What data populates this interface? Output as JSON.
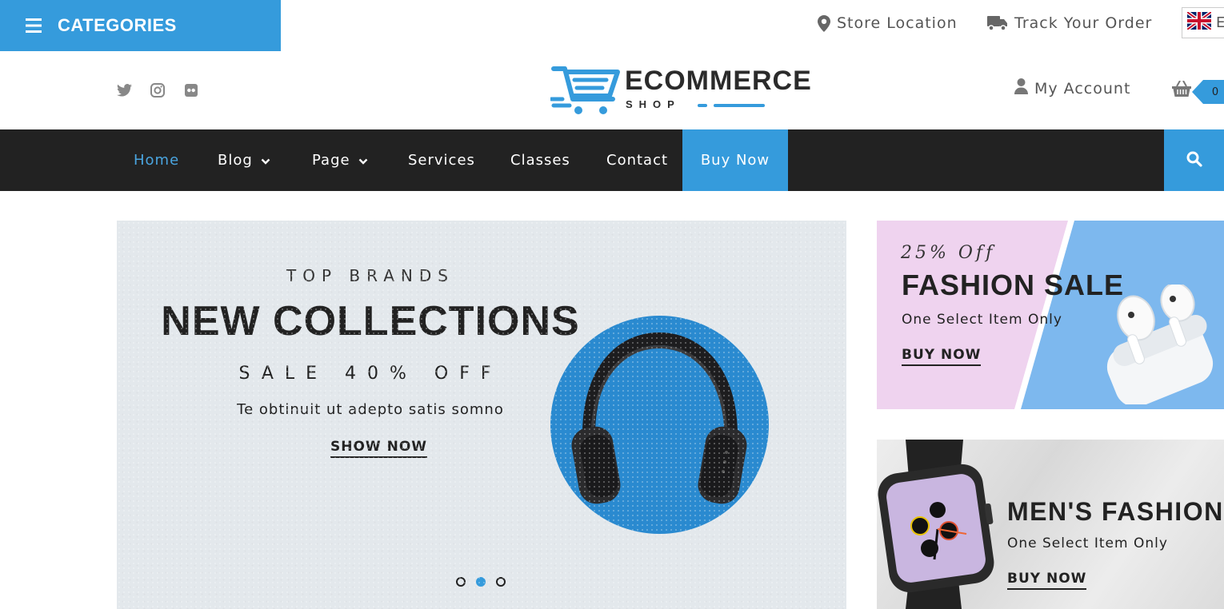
{
  "topbar": {
    "categories_label": "CATEGORIES",
    "store_location": "Store Location",
    "track_order": "Track Your Order",
    "language_partial": "E"
  },
  "header": {
    "logo_word": "ECOMMERCE",
    "logo_sub": "SHOP",
    "social": [
      "twitter-icon",
      "instagram-icon",
      "flickr-icon"
    ],
    "account_label": "My Account",
    "cart_count": "0"
  },
  "nav": {
    "items": [
      {
        "label": "Home",
        "active": true
      },
      {
        "label": "Blog",
        "dropdown": true
      },
      {
        "label": "Page",
        "dropdown": true
      },
      {
        "label": "Services"
      },
      {
        "label": "Classes"
      },
      {
        "label": "Contact"
      }
    ],
    "buy_now": "Buy Now"
  },
  "hero": {
    "kicker": "TOP BRANDS",
    "title": "NEW COLLECTIONS",
    "sale": "SALE 40% OFF",
    "description": "Te obtinuit ut adepto satis somno",
    "button": "SHOW NOW",
    "slides": 3,
    "active_slide": 2
  },
  "banner_fashion": {
    "script": "25% Off",
    "title": "FASHION SALE",
    "subtitle": "One Select Item Only",
    "button": "BUY NOW"
  },
  "banner_mens": {
    "title": "MEN'S FASHION",
    "subtitle": "One Select Item Only",
    "button": "BUY NOW"
  },
  "colors": {
    "accent": "#359bdc",
    "nav_bg": "#222222",
    "hero_bg": "#e3e8ec"
  }
}
